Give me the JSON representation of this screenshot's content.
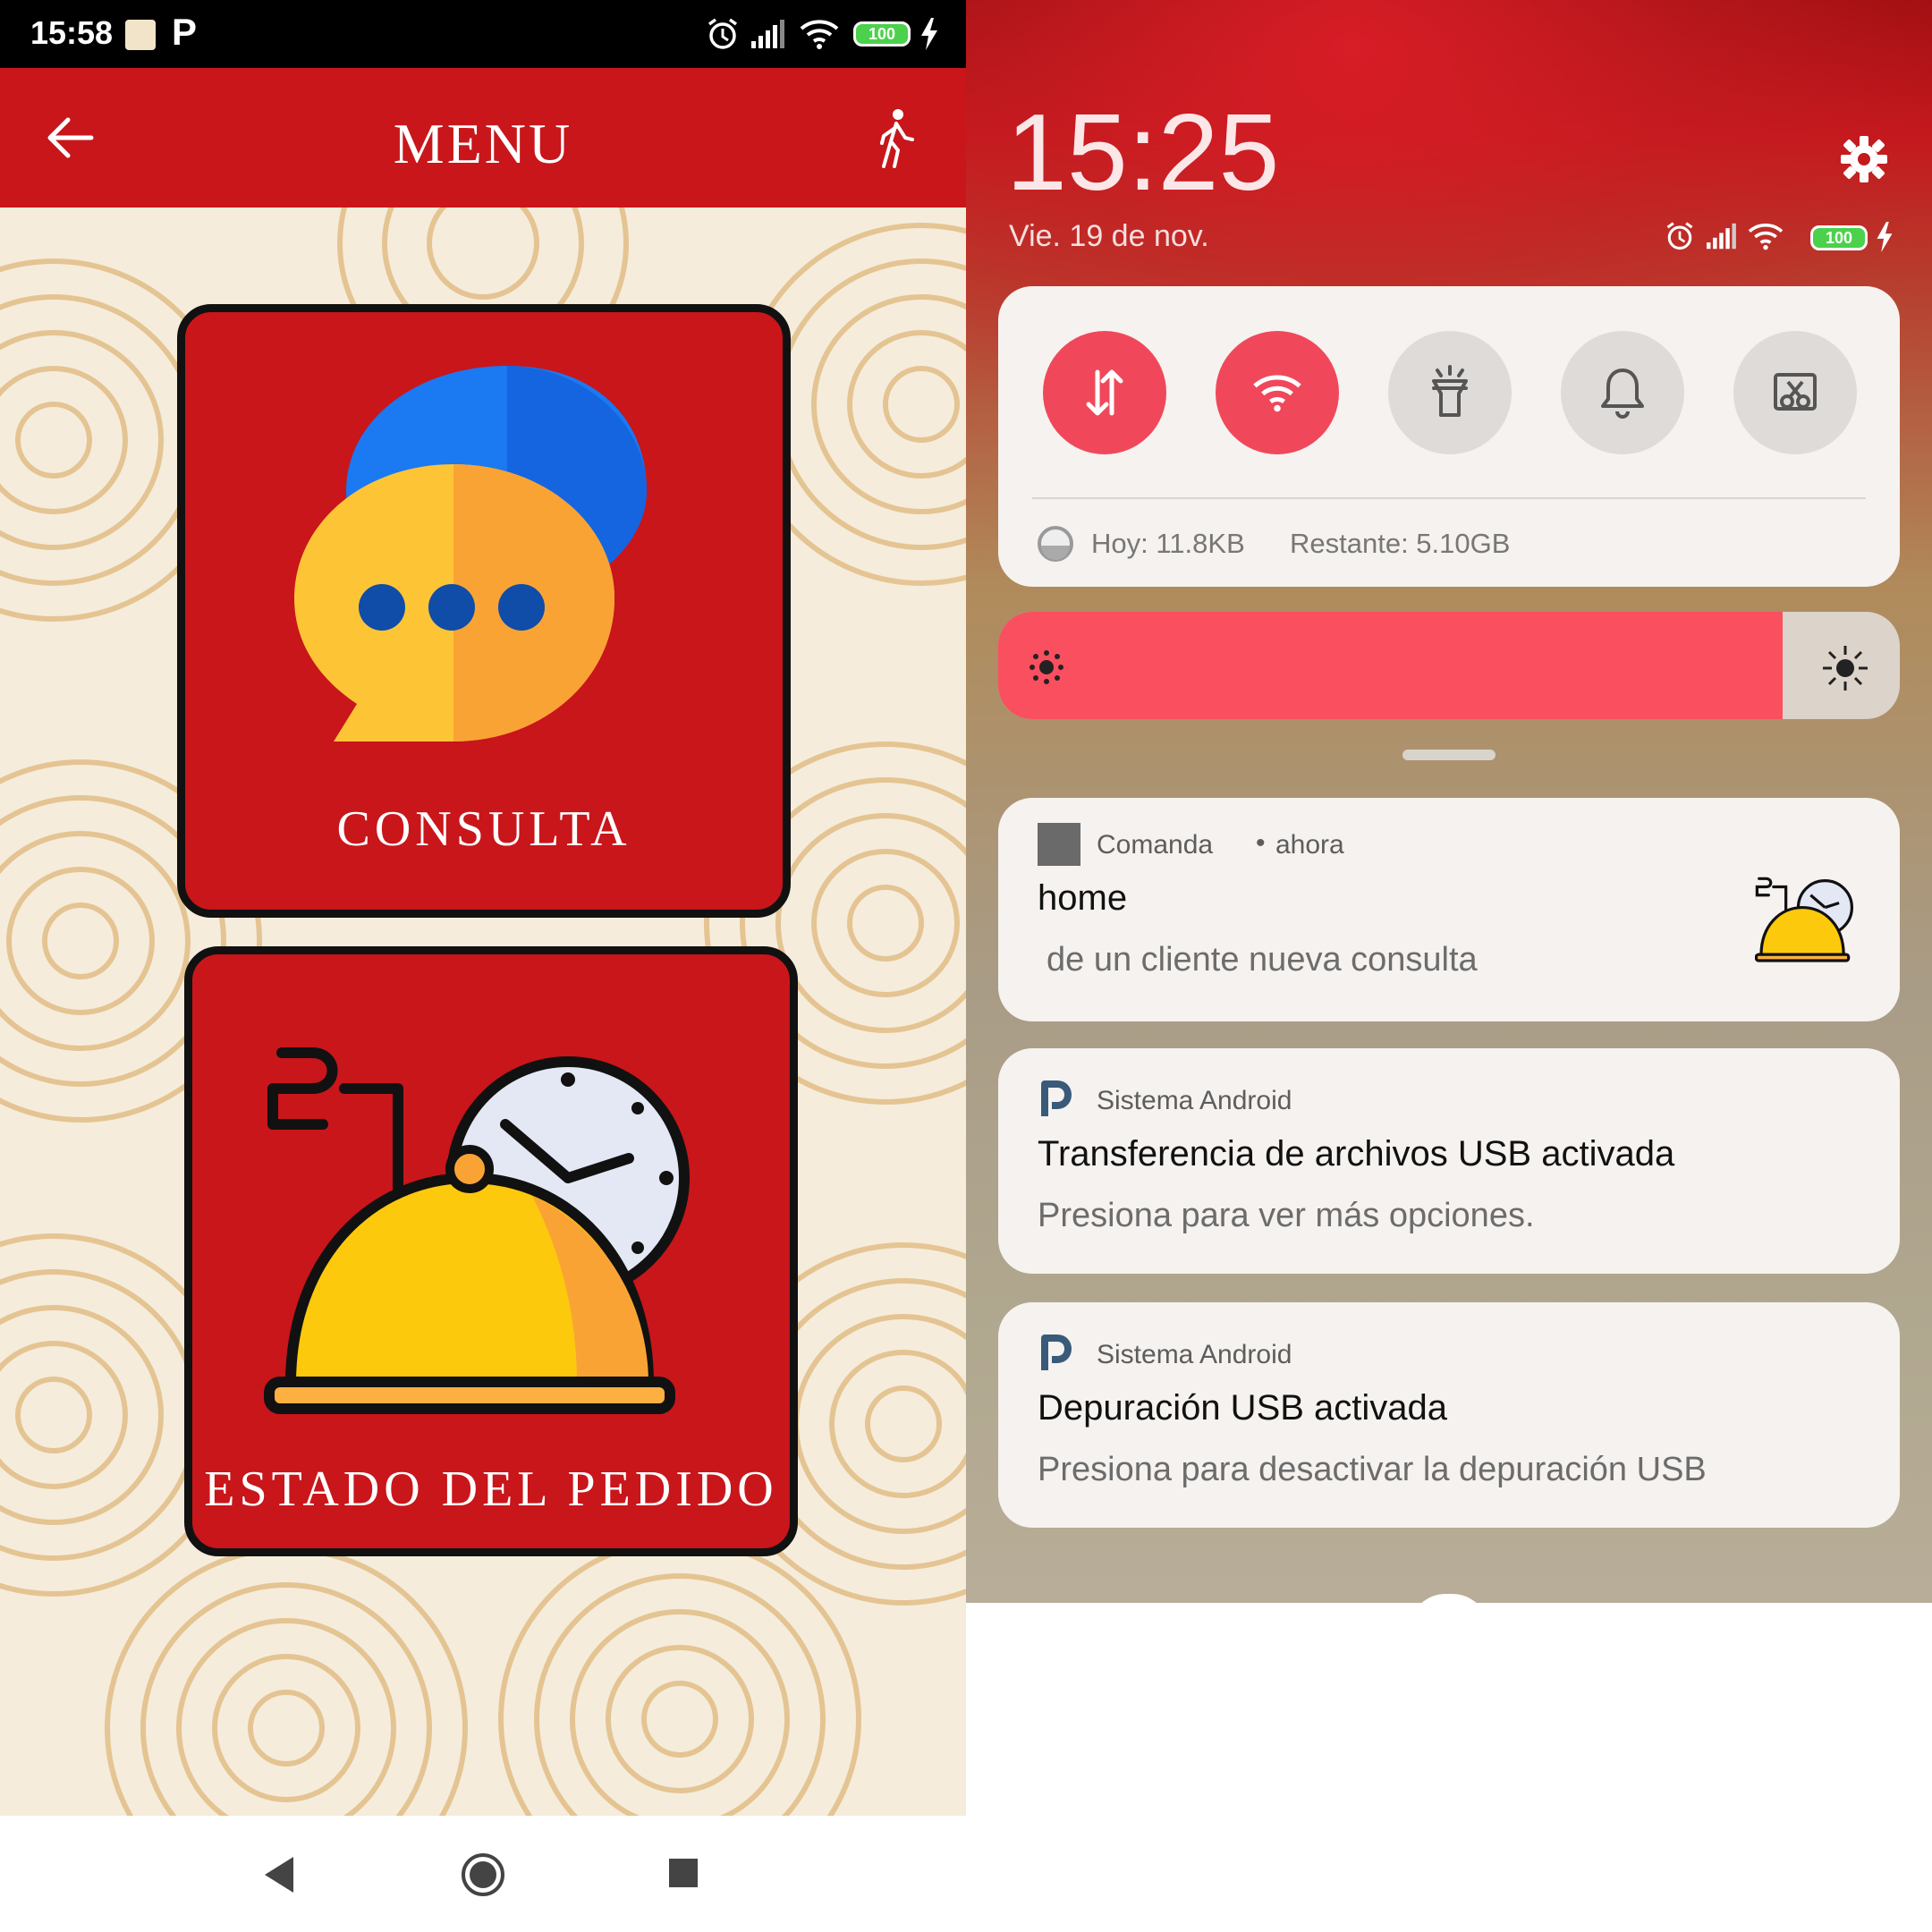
{
  "left_phone": {
    "status_bar": {
      "time": "15:58",
      "battery": "100"
    },
    "app_bar": {
      "title": "MENU"
    },
    "tiles": [
      {
        "label": "CONSULTA"
      },
      {
        "label": "ESTADO DEL PEDIDO"
      }
    ]
  },
  "right_phone": {
    "clock": "15:25",
    "date": "Vie. 19 de nov.",
    "battery": "100",
    "data_usage": {
      "today": "Hoy: 11.8KB",
      "remaining": "Restante: 5.10GB"
    },
    "brightness_level": 0.87,
    "notifications": [
      {
        "app": "Comanda",
        "time": "ahora",
        "title": "home",
        "text": "de un cliente nueva consulta"
      },
      {
        "app": "Sistema Android",
        "title": "Transferencia de archivos USB activada",
        "text": "Presiona para ver más opciones."
      },
      {
        "app": "Sistema Android",
        "title": "Depuración USB activada",
        "text": "Presiona para desactivar la depuración USB"
      }
    ]
  },
  "colors": {
    "primary_red": "#c8161b",
    "toggle_on": "#f0485a",
    "brightness": "#f94f5f"
  }
}
